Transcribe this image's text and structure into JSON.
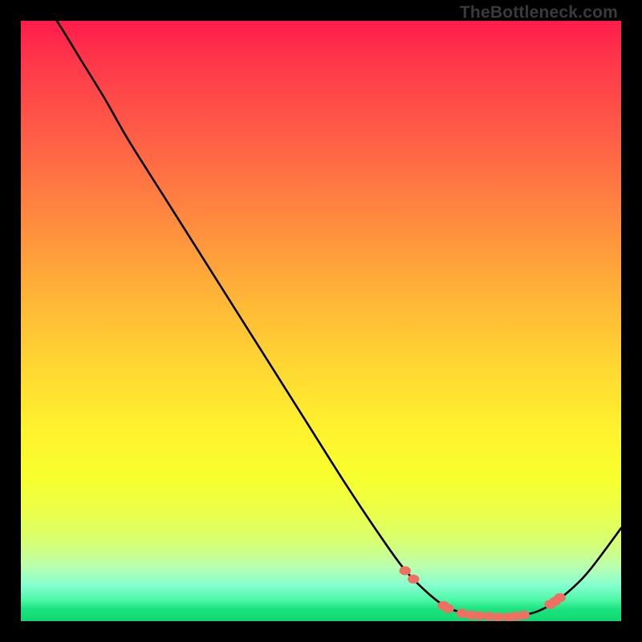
{
  "watermark": "TheBottleneck.com",
  "chart_data": {
    "type": "line",
    "title": "",
    "xlabel": "",
    "ylabel": "",
    "xlim": [
      0,
      100
    ],
    "ylim": [
      0,
      100
    ],
    "grid": false,
    "legend": false,
    "series": [
      {
        "name": "curve",
        "x": [
          0,
          6,
          10,
          14,
          18,
          24,
          30,
          36,
          42,
          48,
          54,
          60,
          64,
          68,
          71,
          74,
          77,
          80,
          83,
          86,
          89,
          92,
          95,
          100
        ],
        "y": [
          109,
          100,
          93.5,
          87,
          80,
          70.5,
          61,
          51.5,
          42,
          32.5,
          23,
          14,
          8.5,
          4.5,
          2.3,
          1.3,
          0.8,
          0.7,
          0.9,
          1.6,
          3.2,
          5.6,
          8.8,
          15.5
        ]
      }
    ],
    "markers": {
      "name": "dots",
      "color": "#ef6f62",
      "points": [
        {
          "x": 64.0,
          "y": 8.4
        },
        {
          "x": 65.4,
          "y": 7.0
        },
        {
          "x": 70.4,
          "y": 2.6
        },
        {
          "x": 71.2,
          "y": 2.1
        },
        {
          "x": 73.5,
          "y": 1.3
        },
        {
          "x": 75.0,
          "y": 1.0
        },
        {
          "x": 76.4,
          "y": 0.9
        },
        {
          "x": 78.0,
          "y": 0.8
        },
        {
          "x": 79.5,
          "y": 0.7
        },
        {
          "x": 81.2,
          "y": 0.7
        },
        {
          "x": 82.5,
          "y": 0.8
        },
        {
          "x": 83.8,
          "y": 1.0
        },
        {
          "x": 88.2,
          "y": 2.8
        },
        {
          "x": 89.0,
          "y": 3.3
        },
        {
          "x": 89.8,
          "y": 3.9
        }
      ]
    }
  }
}
